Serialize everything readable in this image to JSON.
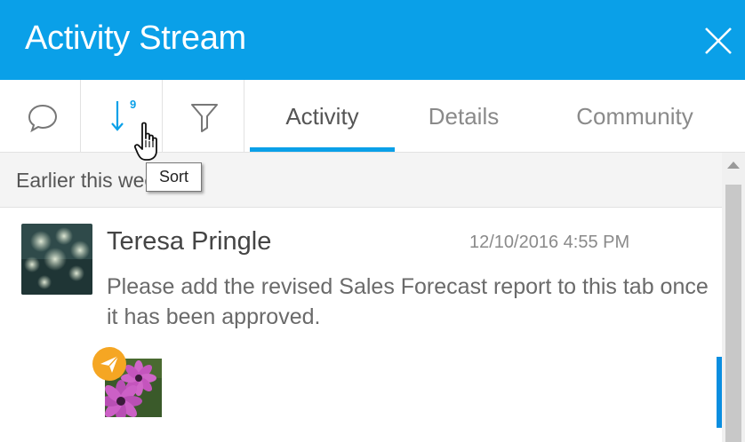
{
  "header": {
    "title": "Activity Stream",
    "background": "#0aa0e8"
  },
  "toolbar": {
    "comment_icon": "speech-bubble-icon",
    "sort_icon": "sort-arrow-icon",
    "sort_badge": "9",
    "filter_icon": "funnel-icon",
    "tabs": [
      {
        "label": "Activity",
        "active": true
      },
      {
        "label": "Details",
        "active": false
      },
      {
        "label": "Community",
        "active": false
      }
    ]
  },
  "tooltip": {
    "text": "Sort"
  },
  "section": {
    "label": "Earlier this week"
  },
  "activity": {
    "author": "Teresa Pringle",
    "timestamp": "12/10/2016 4:55 PM",
    "message": "Please add the revised Sales Forecast report to this tab once it has been approved."
  },
  "colors": {
    "accent": "#0aa0e8",
    "badge": "#f5a623"
  }
}
